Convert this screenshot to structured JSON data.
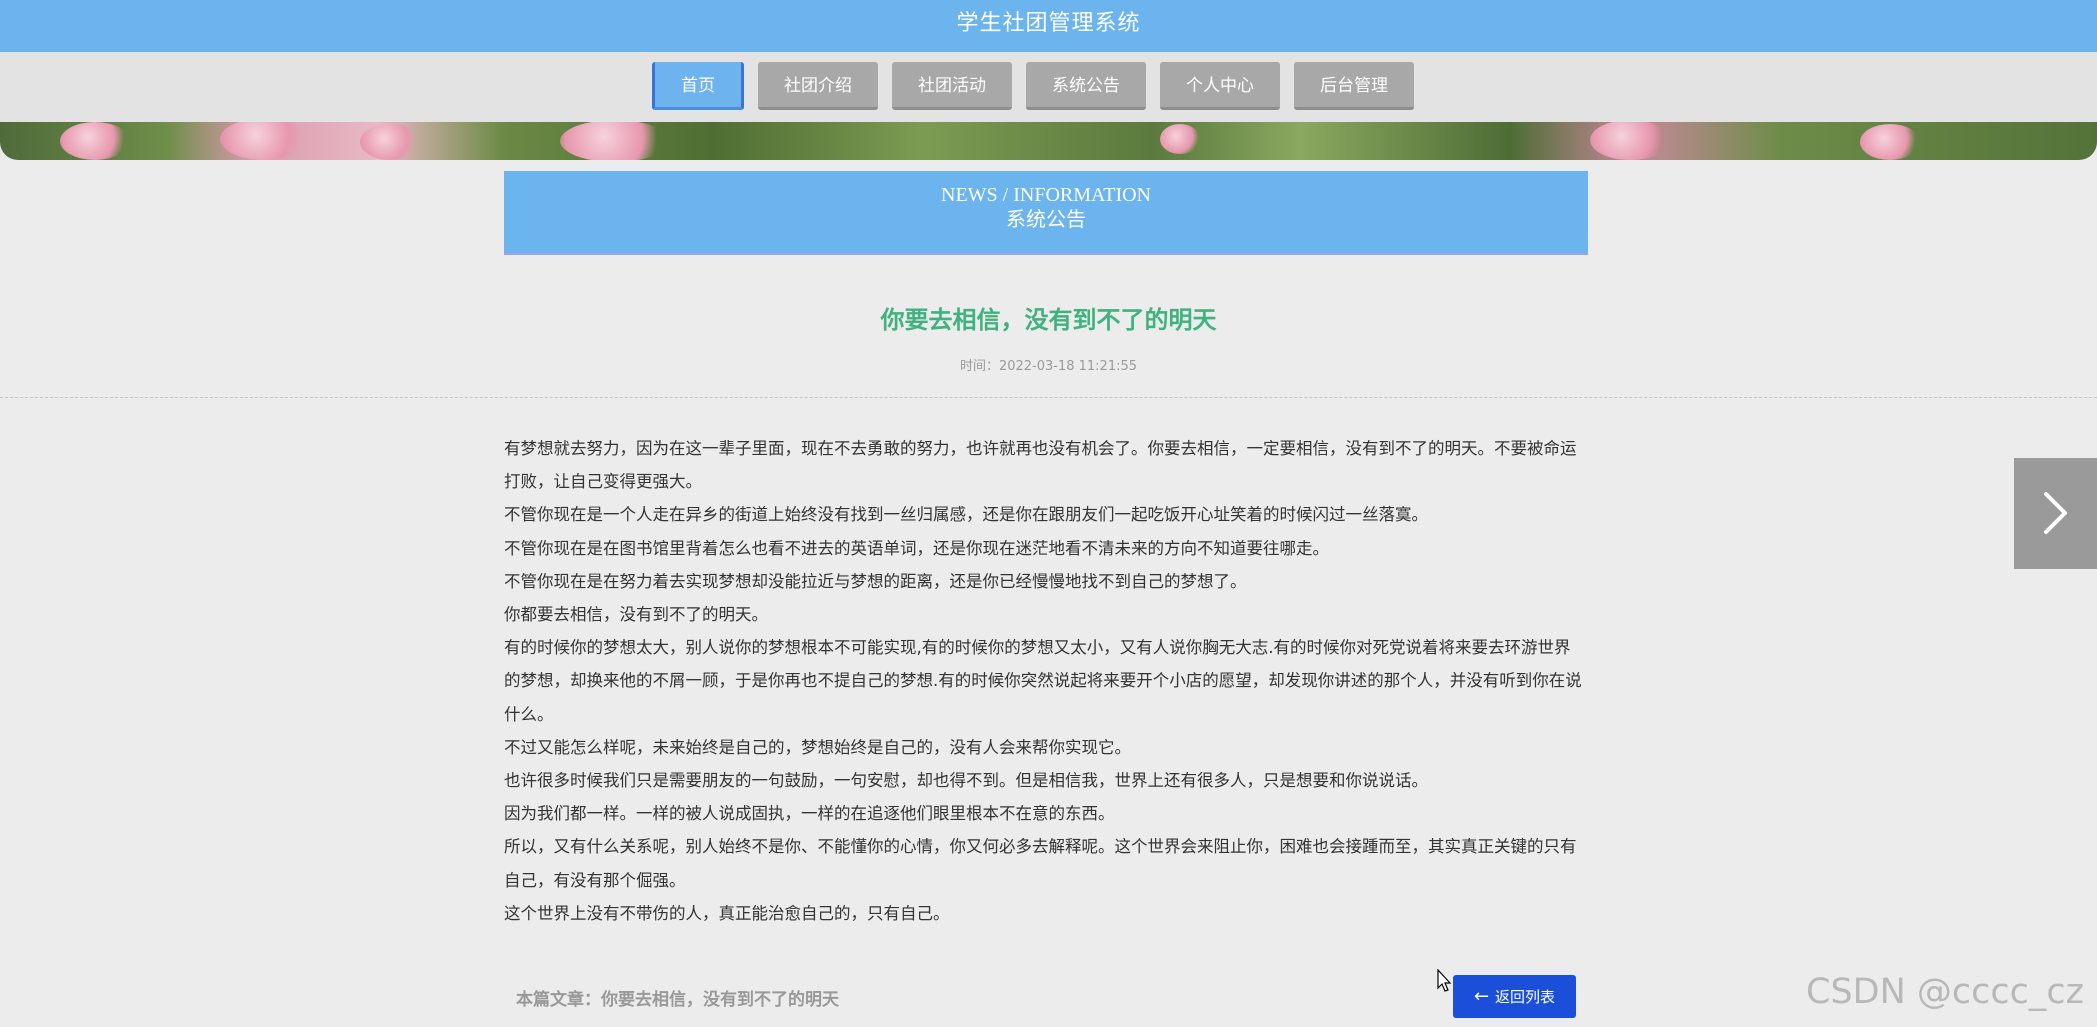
{
  "header": {
    "site_title": "学生社团管理系统"
  },
  "nav": {
    "items": [
      {
        "label": "首页",
        "active": true
      },
      {
        "label": "社团介绍",
        "active": false
      },
      {
        "label": "社团活动",
        "active": false
      },
      {
        "label": "系统公告",
        "active": false
      },
      {
        "label": "个人中心",
        "active": false
      },
      {
        "label": "后台管理",
        "active": false
      }
    ]
  },
  "section": {
    "title_en": "NEWS / INFORMATION",
    "title_cn": "系统公告"
  },
  "article": {
    "title": "你要去相信，没有到不了的明天",
    "time": "时间：2022-03-18 11:21:55",
    "paragraphs": [
      "有梦想就去努力，因为在这一辈子里面，现在不去勇敢的努力，也许就再也没有机会了。你要去相信，一定要相信，没有到不了的明天。不要被命运打败，让自己变得更强大。",
      "不管你现在是一个人走在异乡的街道上始终没有找到一丝归属感，还是你在跟朋友们一起吃饭开心址笑着的时候闪过一丝落寞。",
      "不管你现在是在图书馆里背着怎么也看不进去的英语单词，还是你现在迷茫地看不清未来的方向不知道要往哪走。",
      "不管你现在是在努力着去实现梦想却没能拉近与梦想的距离，还是你已经慢慢地找不到自己的梦想了。",
      "你都要去相信，没有到不了的明天。",
      "有的时候你的梦想太大，别人说你的梦想根本不可能实现,有的时候你的梦想又太小，又有人说你胸无大志.有的时候你对死党说着将来要去环游世界的梦想，却换来他的不屑一顾，于是你再也不提自己的梦想.有的时候你突然说起将来要开个小店的愿望，却发现你讲述的那个人，并没有听到你在说什么。",
      "不过又能怎么样呢，未来始终是自己的，梦想始终是自己的，没有人会来帮你实现它。",
      "也许很多时候我们只是需要朋友的一句鼓励，一句安慰，却也得不到。但是相信我，世界上还有很多人，只是想要和你说说话。",
      "因为我们都一样。一样的被人说成固执，一样的在追逐他们眼里根本不在意的东西。",
      "所以，又有什么关系呢，别人始终不是你、不能懂你的心情，你又何必多去解释呢。这个世界会来阻止你，困难也会接踵而至，其实真正关键的只有自己，有没有那个倔强。",
      "这个世界上没有不带伤的人，真正能治愈自己的，只有自己。"
    ],
    "footer_label": "本篇文章：你要去相信，没有到不了的明天",
    "back_button_label": "返回列表"
  },
  "watermark": "CSDN @cccc_cz",
  "colors": {
    "primary": "#6cb4ee",
    "title_green": "#3fb27f",
    "button_blue": "#1c4fd9",
    "nav_inactive": "#a8a8a8"
  },
  "icons": {
    "back": "arrow-left-icon",
    "next": "chevron-right-icon"
  }
}
